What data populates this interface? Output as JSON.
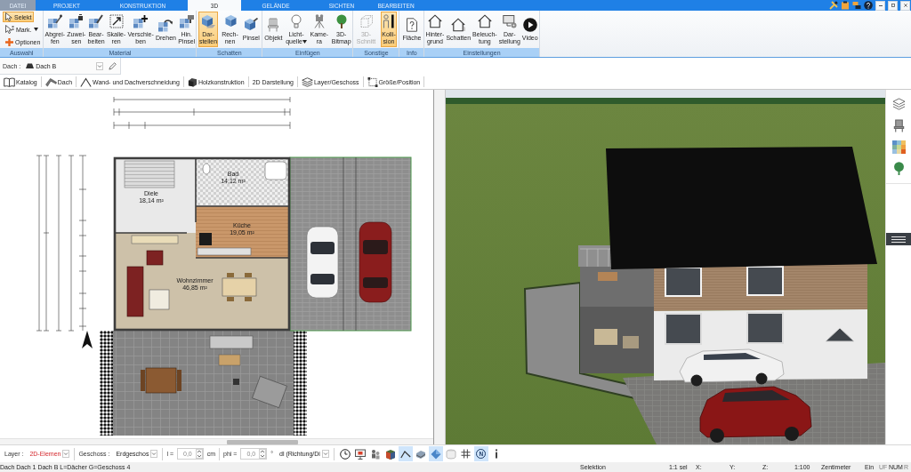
{
  "tabs": [
    {
      "label": "DATEI",
      "kind": "file",
      "selected": false
    },
    {
      "label": "PROJEKT",
      "kind": "tab",
      "selected": false
    },
    {
      "label": "KONSTRUKTION",
      "kind": "tab",
      "selected": false
    },
    {
      "label": "3D",
      "kind": "tab",
      "selected": true
    },
    {
      "label": "GELÄNDE",
      "kind": "tab",
      "selected": false
    },
    {
      "label": "SICHTEN",
      "kind": "tab",
      "selected": false
    },
    {
      "label": "BEARBEITEN",
      "kind": "tab",
      "selected": false
    }
  ],
  "ribbon": [
    {
      "label": "Auswahl",
      "kind": "small",
      "items": [
        {
          "lines": [
            "Selekt"
          ],
          "selected": true,
          "disabled": false,
          "dropdown": false
        },
        {
          "lines": [
            "Mark."
          ],
          "selected": false,
          "disabled": false,
          "dropdown": true
        },
        {
          "lines": [
            "Optionen"
          ],
          "selected": false,
          "disabled": false,
          "dropdown": false
        }
      ]
    },
    {
      "label": "Material",
      "kind": "large",
      "items": [
        {
          "lines": [
            "Abgrei-",
            "fen"
          ],
          "selected": false,
          "disabled": false,
          "dropdown": false
        },
        {
          "lines": [
            "Zuwei-",
            "sen"
          ],
          "selected": false,
          "disabled": false,
          "dropdown": false
        },
        {
          "lines": [
            "Bear-",
            "beiten"
          ],
          "selected": false,
          "disabled": false,
          "dropdown": false
        },
        {
          "lines": [
            "Skalie-",
            "ren"
          ],
          "selected": false,
          "disabled": false,
          "dropdown": false
        },
        {
          "lines": [
            "Verschie-",
            "ben"
          ],
          "selected": false,
          "disabled": false,
          "dropdown": false
        },
        {
          "lines": [
            "Drehen"
          ],
          "selected": false,
          "disabled": false,
          "dropdown": false
        },
        {
          "lines": [
            "Hin.",
            "Pinsel"
          ],
          "selected": false,
          "disabled": false,
          "dropdown": false
        }
      ]
    },
    {
      "label": "Schatten",
      "kind": "large",
      "items": [
        {
          "lines": [
            "Dar-",
            "stellen"
          ],
          "selected": true,
          "disabled": false,
          "dropdown": false
        },
        {
          "lines": [
            "Rech-",
            "nen"
          ],
          "selected": false,
          "disabled": false,
          "dropdown": false
        },
        {
          "lines": [
            "Pinsel"
          ],
          "selected": false,
          "disabled": false,
          "dropdown": false
        }
      ]
    },
    {
      "label": "Einfügen",
      "kind": "large",
      "items": [
        {
          "lines": [
            "Objekt"
          ],
          "selected": false,
          "disabled": false,
          "dropdown": false
        },
        {
          "lines": [
            "Licht-",
            "quelle"
          ],
          "selected": false,
          "disabled": false,
          "dropdown": true
        },
        {
          "lines": [
            "Kame-",
            "ra"
          ],
          "selected": false,
          "disabled": false,
          "dropdown": false
        },
        {
          "lines": [
            "3D-",
            "Bitmap"
          ],
          "selected": false,
          "disabled": false,
          "dropdown": false
        }
      ]
    },
    {
      "label": "Sonstige",
      "kind": "large",
      "items": [
        {
          "lines": [
            "3D-",
            "Schnitt"
          ],
          "selected": false,
          "disabled": true,
          "dropdown": false
        },
        {
          "lines": [
            "Kolli-",
            "sion"
          ],
          "selected": true,
          "disabled": false,
          "dropdown": false
        }
      ]
    },
    {
      "label": "Info",
      "kind": "large",
      "items": [
        {
          "lines": [
            "Fläche"
          ],
          "selected": false,
          "disabled": false,
          "dropdown": false
        }
      ]
    },
    {
      "label": "Einstellungen",
      "kind": "large",
      "items": [
        {
          "lines": [
            "Hinter-",
            "grund"
          ],
          "selected": false,
          "disabled": false,
          "dropdown": false
        },
        {
          "lines": [
            "Schatten"
          ],
          "selected": false,
          "disabled": false,
          "dropdown": false
        },
        {
          "lines": [
            "Beleuch-",
            "tung"
          ],
          "selected": false,
          "disabled": false,
          "dropdown": false
        },
        {
          "lines": [
            "Dar-",
            "stellung"
          ],
          "selected": false,
          "disabled": false,
          "dropdown": false
        },
        {
          "lines": [
            "Video"
          ],
          "selected": false,
          "disabled": false,
          "dropdown": false
        }
      ]
    }
  ],
  "selector": {
    "label": "Dach :",
    "value": "Dach B"
  },
  "toolbar": [
    "Katalog",
    "Dach",
    "Wand- und Dachverschneidung",
    "Holzkonstruktion",
    "2D Darstellung",
    "Layer/Geschoss",
    "Größe/Position"
  ],
  "plan": {
    "rooms": [
      {
        "name": "Diele",
        "area": "18,14 m²"
      },
      {
        "name": "Bad",
        "area": "14,12 m²"
      },
      {
        "name": "Küche",
        "area": "19,05 m²"
      },
      {
        "name": "Wohnzimmer",
        "area": "46,85 m²"
      }
    ]
  },
  "edit_bar": {
    "layer": {
      "label": "Layer :",
      "value": "2D-Elemen"
    },
    "floor": {
      "label": "Geschoss :",
      "value": "Erdgeschos"
    },
    "length": {
      "label": "l =",
      "value": "0,0",
      "unit": "cm",
      "disabled": true
    },
    "angle": {
      "label": "phi =",
      "value": "0,0",
      "unit": "°",
      "disabled": true
    },
    "direction": {
      "value": "dl (Richtung/Di"
    },
    "tools": [
      {
        "selected": false
      },
      {
        "selected": false
      },
      {
        "selected": false
      },
      {
        "selected": false
      },
      {
        "selected": true
      },
      {
        "selected": false
      },
      {
        "selected": true
      },
      {
        "selected": false
      },
      {
        "selected": false
      },
      {
        "selected": true,
        "label": "N"
      },
      {
        "selected": false
      }
    ]
  },
  "status_bar": {
    "message": "Dach Dach 1 Dach B L=Dächer G=Geschoss 4",
    "cells": [
      "Selektion",
      "1:1 sel",
      "X:",
      "Y:",
      "Z:",
      "1:100",
      "Zentimeter",
      "Ein"
    ],
    "indicators": [
      {
        "label": "UF",
        "on": false
      },
      {
        "label": "NUM",
        "on": true
      },
      {
        "label": "R",
        "on": false
      }
    ]
  }
}
